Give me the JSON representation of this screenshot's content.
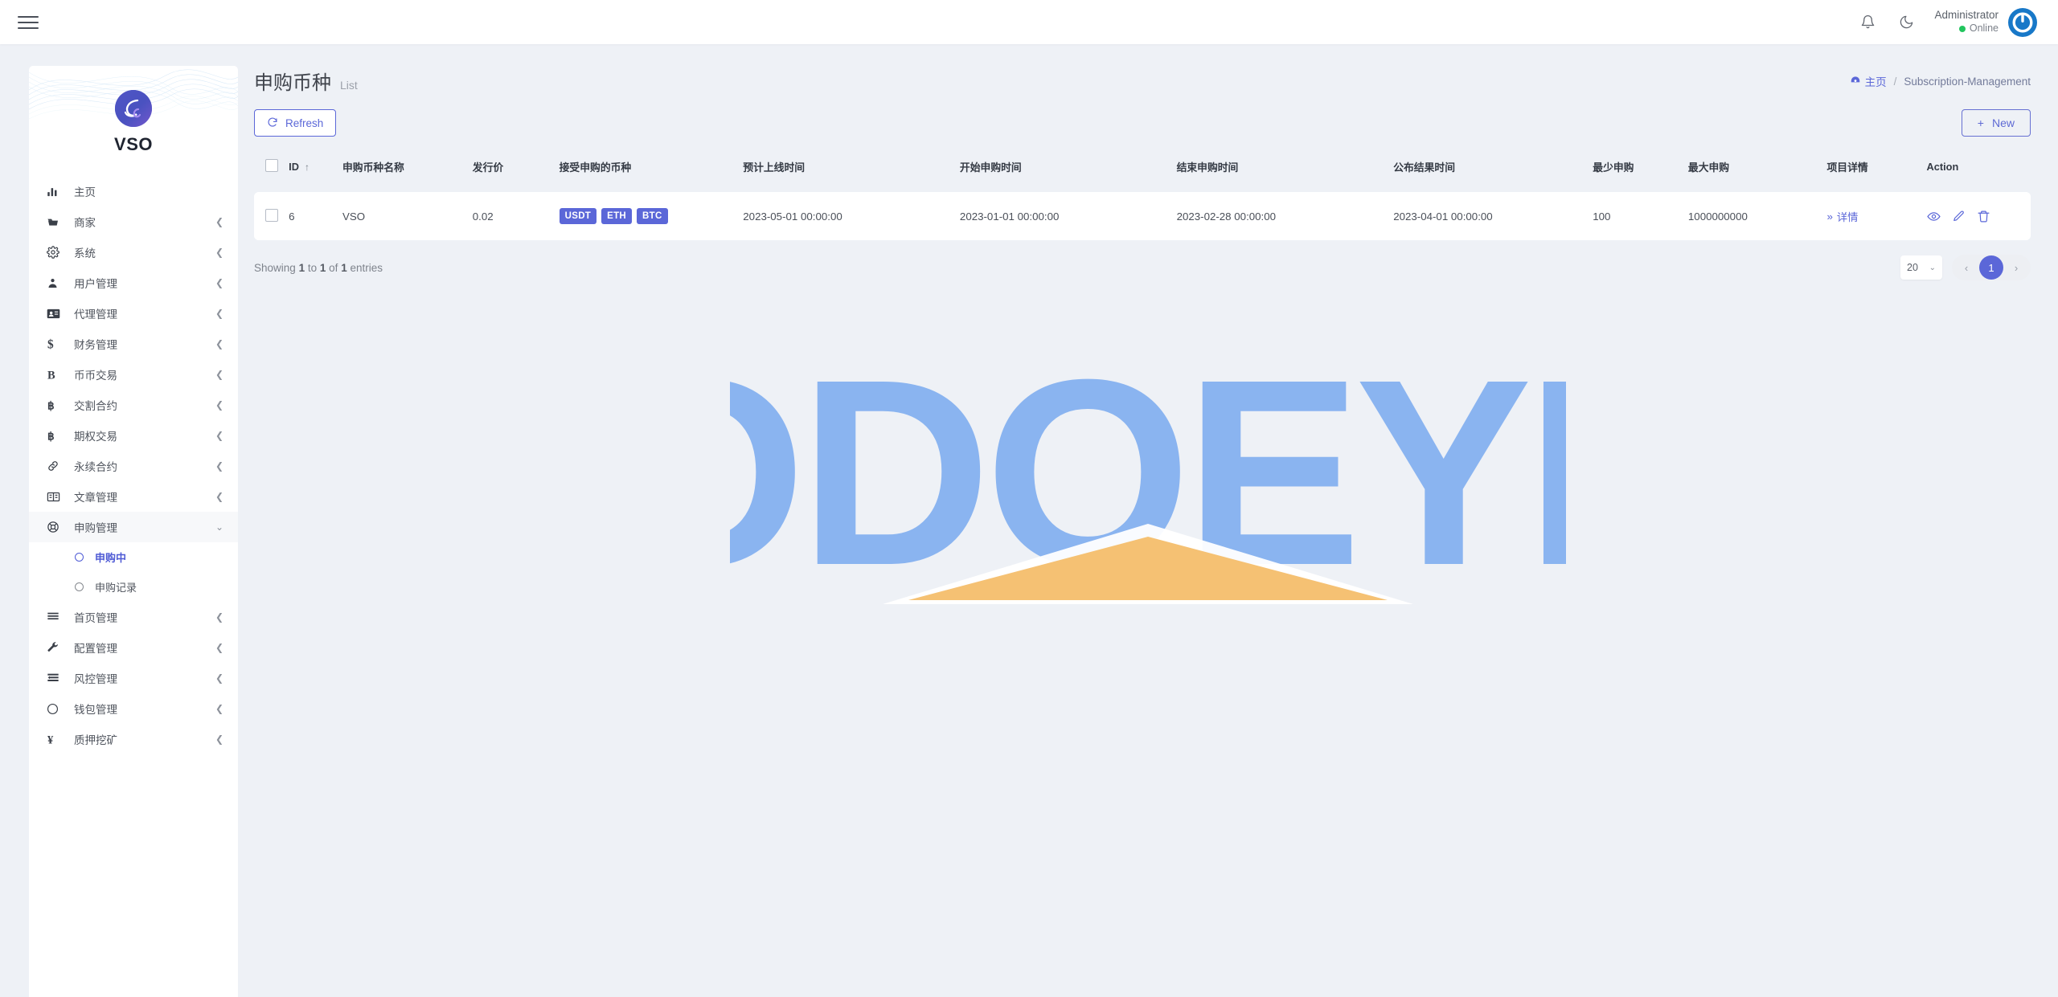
{
  "topbar": {
    "menu_icon": "hamburger-icon",
    "bell_icon": "bell-icon",
    "theme_icon": "moon-icon",
    "user_name": "Administrator",
    "user_status": "Online"
  },
  "sidebar": {
    "brand_name": "VSO",
    "items": [
      {
        "label": "主页",
        "icon": "chart-bars-icon",
        "expandable": false
      },
      {
        "label": "商家",
        "icon": "merchant-icon",
        "expandable": true
      },
      {
        "label": "系统",
        "icon": "gear-icon",
        "expandable": true
      },
      {
        "label": "用户管理",
        "icon": "user-group-icon",
        "expandable": true
      },
      {
        "label": "代理管理",
        "icon": "id-card-icon",
        "expandable": true
      },
      {
        "label": "财务管理",
        "icon": "dollar-icon",
        "expandable": true
      },
      {
        "label": "币币交易",
        "icon": "letter-b-icon",
        "expandable": true
      },
      {
        "label": "交割合约",
        "icon": "bitcoin-icon",
        "expandable": true
      },
      {
        "label": "期权交易",
        "icon": "bitcoin-icon",
        "expandable": true
      },
      {
        "label": "永续合约",
        "icon": "link-icon",
        "expandable": true
      },
      {
        "label": "文章管理",
        "icon": "newspaper-icon",
        "expandable": true
      },
      {
        "label": "申购管理",
        "icon": "lifebuoy-icon",
        "expandable": true,
        "expanded": true,
        "children": [
          {
            "label": "申购中",
            "selected": true
          },
          {
            "label": "申购记录",
            "selected": false
          }
        ]
      },
      {
        "label": "首页管理",
        "icon": "lines-icon",
        "expandable": true
      },
      {
        "label": "配置管理",
        "icon": "wrench-icon",
        "expandable": true
      },
      {
        "label": "风控管理",
        "icon": "risk-icon",
        "expandable": true
      },
      {
        "label": "钱包管理",
        "icon": "circle-icon",
        "expandable": true
      },
      {
        "label": "质押挖矿",
        "icon": "yen-icon",
        "expandable": true
      }
    ]
  },
  "page": {
    "title": "申购币种",
    "subtitle": "List",
    "breadcrumb_home": "主页",
    "breadcrumb_sep": "/",
    "breadcrumb_current": "Subscription-Management",
    "refresh_label": "Refresh",
    "new_label": "New",
    "new_plus": "+"
  },
  "table": {
    "columns": [
      {
        "key": "chk",
        "label": "",
        "sorted": false
      },
      {
        "key": "id",
        "label": "ID",
        "sorted": true,
        "sort_dir": "↑"
      },
      {
        "key": "name",
        "label": "申购币种名称",
        "sorted": false
      },
      {
        "key": "price",
        "label": "发行价",
        "sorted": false
      },
      {
        "key": "coins",
        "label": "接受申购的币种",
        "sorted": false
      },
      {
        "key": "t1",
        "label": "预计上线时间",
        "sorted": false
      },
      {
        "key": "t2",
        "label": "开始申购时间",
        "sorted": false
      },
      {
        "key": "t3",
        "label": "结束申购时间",
        "sorted": false
      },
      {
        "key": "t4",
        "label": "公布结果时间",
        "sorted": false
      },
      {
        "key": "min",
        "label": "最少申购",
        "sorted": false
      },
      {
        "key": "max",
        "label": "最大申购",
        "sorted": false
      },
      {
        "key": "det",
        "label": "项目详情",
        "sorted": false
      },
      {
        "key": "act",
        "label": "Action",
        "sorted": false
      }
    ],
    "rows": [
      {
        "id": "6",
        "name": "VSO",
        "price": "0.02",
        "coins": [
          "USDT",
          "ETH",
          "BTC"
        ],
        "t1": "2023-05-01 00:00:00",
        "t2": "2023-01-01 00:00:00",
        "t3": "2023-02-28 00:00:00",
        "t4": "2023-04-01 00:00:00",
        "min": "100",
        "max": "1000000000",
        "detail_label": "详情",
        "detail_chevrons": "»",
        "actions": [
          "eye-icon",
          "pencil-icon",
          "trash-icon"
        ]
      }
    ]
  },
  "footer": {
    "entries_prefix": "Showing",
    "entries_from": "1",
    "entries_to_word": "to",
    "entries_to": "1",
    "entries_of_word": "of",
    "entries_total": "1",
    "entries_suffix": "entries",
    "per_page": "20",
    "prev": "‹",
    "current_page": "1",
    "next": "›"
  },
  "watermark": {
    "text": "ODOEYE",
    "text_color": "#8ab4f0",
    "triangle_color": "#f5c173"
  },
  "colors": {
    "accent": "#5b67d8",
    "page_bg": "#eef1f6",
    "surface": "#ffffff",
    "online": "#22c55e",
    "avatar": "#1878c8"
  }
}
